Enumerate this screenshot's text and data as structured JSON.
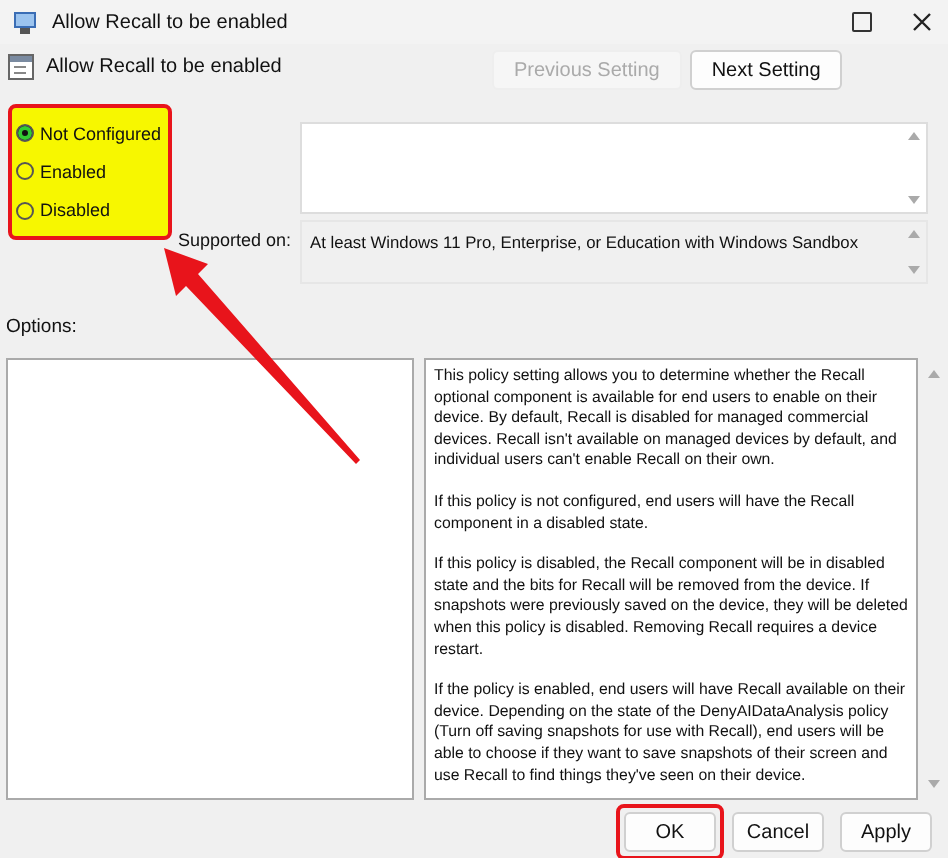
{
  "window": {
    "title": "Allow Recall to be enabled"
  },
  "policy": {
    "name": "Allow Recall to be enabled"
  },
  "nav_buttons": [
    {
      "label": "Previous Setting",
      "disabled": true
    },
    {
      "label": "Next Setting",
      "disabled": false
    }
  ],
  "state_options": {
    "highlighted": true,
    "items": [
      {
        "label": "Not Configured",
        "selected": true
      },
      {
        "label": "Enabled",
        "selected": false
      },
      {
        "label": "Disabled",
        "selected": false
      }
    ]
  },
  "supported_on": {
    "label": "Supported on:",
    "value": "At least Windows 11 Pro, Enterprise, or Education with Windows Sandbox"
  },
  "options": {
    "label": "Options:"
  },
  "help": [
    "This policy setting allows you to determine whether the Recall optional component is available for end users to enable on their device. By default, Recall is disabled for managed commercial devices. Recall isn't available on managed devices by default, and individual users can't enable Recall on their own.",
    "If this policy is not configured, end users will have the Recall component in a disabled state.",
    "If this policy is disabled, the Recall component will be in disabled state and the bits for Recall will be removed from the device. If snapshots were previously saved on the device, they will be deleted when this policy is disabled. Removing Recall requires a device restart.",
    "If the policy is enabled, end users will have Recall available on their device. Depending on the state of the DenyAIDataAnalysis policy (Turn off saving snapshots for use with Recall), end users will be able to choose if they want to save snapshots of their screen and use Recall to find things they've seen on their device."
  ],
  "buttons": [
    {
      "label": "OK",
      "highlighted": true
    },
    {
      "label": "Cancel",
      "highlighted": false
    },
    {
      "label": "Apply",
      "highlighted": false
    }
  ]
}
